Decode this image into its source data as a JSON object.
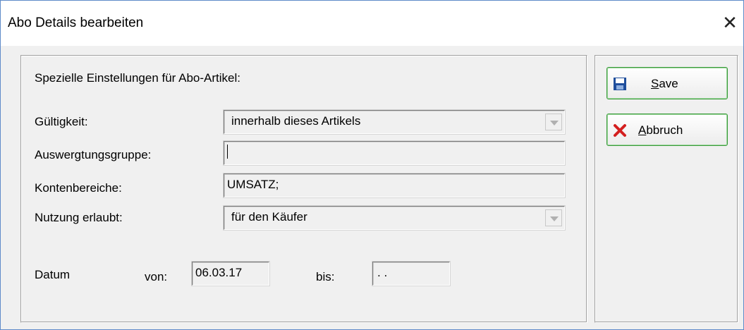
{
  "window": {
    "title": "Abo Details bearbeiten",
    "close_glyph": "✕"
  },
  "form": {
    "heading": "Spezielle Einstellungen für Abo-Artikel:",
    "gueltigkeit_label": "Gültigkeit:",
    "gueltigkeit_value": "innerhalb dieses Artikels",
    "auswertung_label": "Auswergtungsgruppe:",
    "auswertung_value": "",
    "konten_label": "Kontenbereiche:",
    "konten_value": "UMSATZ;",
    "nutzung_label": "Nutzung erlaubt:",
    "nutzung_value": "für den Käufer",
    "datum_label": "Datum",
    "von_label": "von:",
    "von_value": "06.03.17",
    "bis_label": "bis:",
    "bis_value": " .  ."
  },
  "buttons": {
    "save_mnemonic": "S",
    "save_rest": "ave",
    "cancel_mnemonic": "A",
    "cancel_rest": "bbruch",
    "save_icon": "floppy-disk-icon",
    "cancel_icon": "red-x-icon"
  },
  "colors": {
    "button_border": "#3a9a3a",
    "window_border": "#5f8bc9",
    "save_icon": "#1f4e9c",
    "cancel_icon": "#d42020"
  }
}
